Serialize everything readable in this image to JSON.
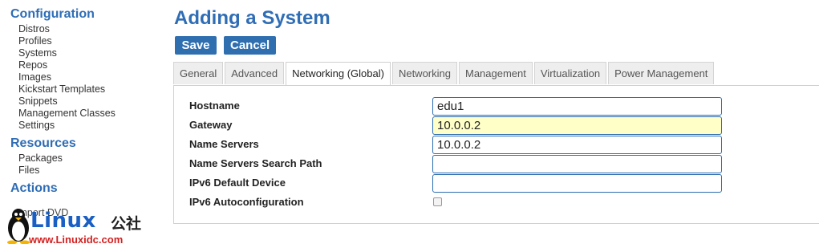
{
  "sidebar": {
    "configuration_heading": "Configuration",
    "configuration_items": [
      "Distros",
      "Profiles",
      "Systems",
      "Repos",
      "Images",
      "Kickstart Templates",
      "Snippets",
      "Management Classes",
      "Settings"
    ],
    "resources_heading": "Resources",
    "resources_items": [
      "Packages",
      "Files"
    ],
    "actions_heading": "Actions",
    "actions_items": [
      "Import DVD"
    ]
  },
  "main": {
    "title": "Adding a System",
    "save_label": "Save",
    "cancel_label": "Cancel",
    "tabs": [
      "General",
      "Advanced",
      "Networking (Global)",
      "Networking",
      "Management",
      "Virtualization",
      "Power Management"
    ],
    "active_tab": "Networking (Global)",
    "fields": {
      "hostname_label": "Hostname",
      "hostname_value": "edu1",
      "gateway_label": "Gateway",
      "gateway_value": "10.0.0.2",
      "name_servers_label": "Name Servers",
      "name_servers_value": "10.0.0.2",
      "search_path_label": "Name Servers Search Path",
      "search_path_value": "",
      "ipv6_device_label": "IPv6 Default Device",
      "ipv6_device_value": "",
      "ipv6_autoconf_label": "IPv6 Autoconfiguration",
      "ipv6_autoconf_checked": false
    }
  },
  "watermark": {
    "brand": "Linux",
    "brand_cn": "公社",
    "url": "www.Linuxidc.com"
  },
  "colors": {
    "accent": "#2f6db5",
    "button": "#2f6fb0",
    "highlight_field": "#ffffc8"
  }
}
